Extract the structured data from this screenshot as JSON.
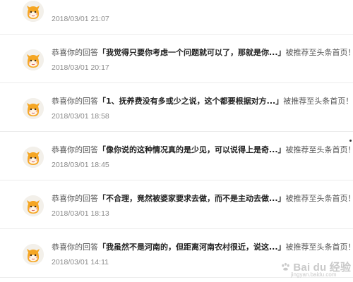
{
  "feed": {
    "items": [
      {
        "prefix": "",
        "quote": "",
        "suffix": "",
        "time": "2018/03/01 21:07"
      },
      {
        "prefix": "恭喜你的回答",
        "quote": "「我觉得只要你考虑一个问题就可以了，那就是你...」",
        "suffix": "被推荐至头条首页！",
        "time": "2018/03/01 20:17"
      },
      {
        "prefix": "恭喜你的回答",
        "quote": "「1、抚养费没有多或少之说，这个都要根据对方...」",
        "suffix": "被推荐至头条首页！",
        "time": "2018/03/01 18:58"
      },
      {
        "prefix": "恭喜你的回答",
        "quote": "「像你说的这种情况真的是少见，可以说得上是奇...」",
        "suffix": "被推荐至头条首页！",
        "time": "2018/03/01 18:45"
      },
      {
        "prefix": "恭喜你的回答",
        "quote": "「不合理，竟然被婆家要求去做，而不是主动去做...」",
        "suffix": "被推荐至头条首页！",
        "time": "2018/03/01 18:13"
      },
      {
        "prefix": "恭喜你的回答",
        "quote": "「我虽然不是河南的，但距离河南农村很近，说这...」",
        "suffix": "被推荐至头条首页！",
        "time": "2018/03/01 14:11"
      }
    ],
    "avatar_icon": "cartoon-mascot-avatar-icon"
  },
  "watermark": {
    "brand": "Bai du 经验",
    "url": "jingyan.baidu.com"
  },
  "colors": {
    "background": "#ffffff",
    "text": "#555555",
    "quote": "#222222",
    "time": "#8a8a8a",
    "divider": "#ececec",
    "avatar_orange": "#f5a623"
  }
}
